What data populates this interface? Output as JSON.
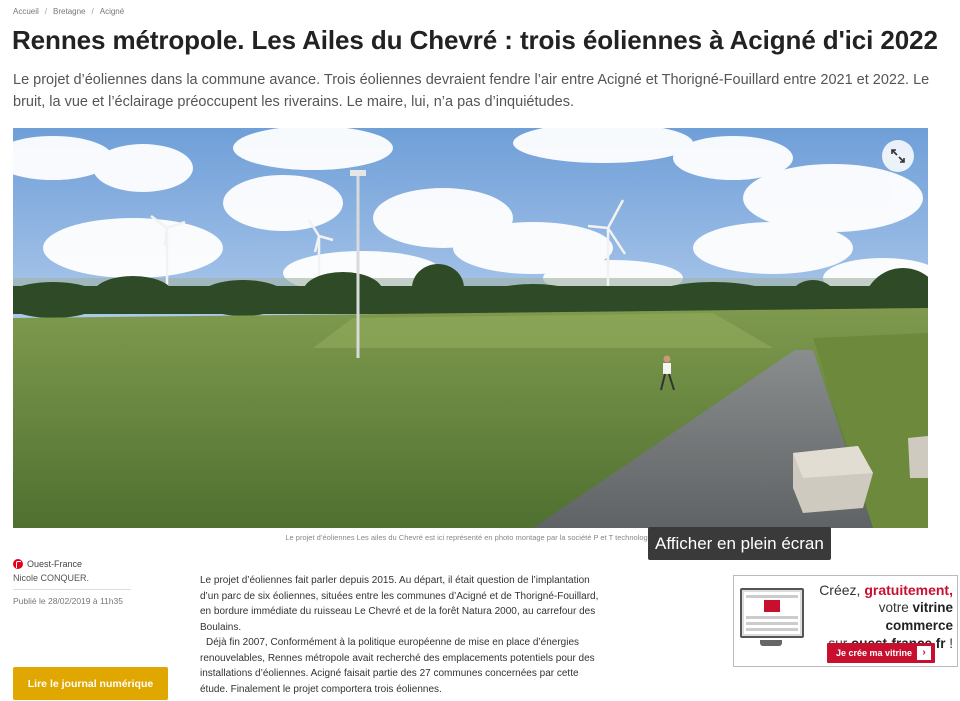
{
  "breadcrumb": {
    "items": [
      "Accueil",
      "Bretagne",
      "Acigné"
    ],
    "separator": "/"
  },
  "article": {
    "title": "Rennes métropole. Les Ailes du Chevré : trois éoliennes à Acigné d'ici 2022",
    "lead": "Le projet d’éoliennes dans la commune avance. Trois éoliennes devraient fendre l’air entre Acigné et Thorigné-Fouillard entre 2021 et 2022. Le bruit, la vue et l’éclairage préoccupent les riverains. Le maire, lui, n’a pas d’inquiétudes.",
    "image_caption": "Le projet d’éoliennes Les ailes du Chevré est ici représenté en photo montage par la société P et T technologie.",
    "body": [
      "Le projet d’éoliennes fait parler depuis 2015. Au départ, il était question de l’implantation d’un parc de six éoliennes, situées entre les communes d’Acigné et de Thorigné-Fouillard, en bordure immédiate du ruisseau Le Chevré et de la forêt Natura 2000, au carrefour des Boulains.",
      "Déjà fin 2007, Conformément à la politique européenne de mise en place d’énergies renouvelables, Rennes métropole avait recherché des emplacements potentiels pour des installations d’éoliennes. Acigné faisait partie des 27 communes concernées par cette étude. Finalement le projet comportera trois éoliennes."
    ]
  },
  "meta": {
    "source": "Ouest-France",
    "author": "Nicole CONQUER.",
    "published": "Publié le 28/02/2019 à 11h35"
  },
  "tooltip": "Afficher en plein écran",
  "icons": {
    "expand": "expand-icon",
    "source_logo": "ouest-france-logo"
  },
  "buttons": {
    "read_journal": "Lire le journal numérique"
  },
  "ad": {
    "line1_plain": "Créez, ",
    "line1_red": "gratuitement,",
    "line2_plain": "votre ",
    "line2_bold": "vitrine commerce",
    "line3_plain": "sur ",
    "line3_bold": "ouest-france.fr",
    "line3_end": " !",
    "cta": "Je crée ma vitrine",
    "cta_arrow": "›",
    "brand_color": "#c8102e"
  },
  "colors": {
    "read_button": "#e0a700",
    "tooltip_bg": "#3a3a3a",
    "brand_red": "#e2001a"
  }
}
